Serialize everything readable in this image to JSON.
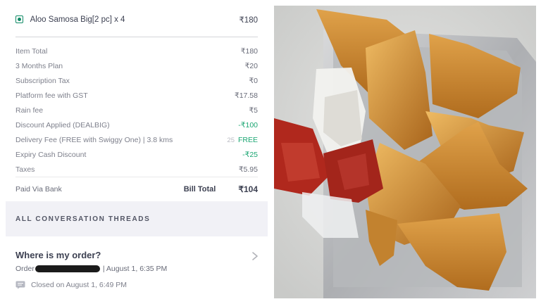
{
  "order": {
    "item_name": "Aloo Samosa Big[2 pc] x 4",
    "item_price": "₹180",
    "veg_icon": "veg-indicator-icon"
  },
  "bill": {
    "rows": [
      {
        "label": "Item Total",
        "value": "₹180"
      },
      {
        "label": "3 Months Plan",
        "value": "₹20"
      },
      {
        "label": "Subscription Tax",
        "value": "₹0"
      },
      {
        "label": "Platform fee with GST",
        "value": "₹17.58"
      },
      {
        "label": "Rain fee",
        "value": "₹5"
      },
      {
        "label": "Discount Applied (DEALBIG)",
        "value": "-₹100"
      },
      {
        "label": "Delivery Fee (FREE with Swiggy One) | 3.8 kms",
        "value": "FREE",
        "struck": "25"
      },
      {
        "label": "Expiry Cash Discount",
        "value": "-₹25"
      },
      {
        "label": "Taxes",
        "value": "₹5.95"
      }
    ],
    "paid_via": "Paid Via Bank",
    "bill_total_label": "Bill Total",
    "bill_total_value": "₹104"
  },
  "threads": {
    "header": "ALL CONVERSATION THREADS",
    "title": "Where is my order?",
    "order_prefix": "Order",
    "order_suffix": "| August 1, 6:35 PM",
    "closed_text": "Closed on August 1, 6:49 PM"
  },
  "colors": {
    "green": "#1ba672",
    "text_dark": "#3d4152",
    "text_muted": "#7e808c",
    "section_bg": "#f1f1f6"
  }
}
